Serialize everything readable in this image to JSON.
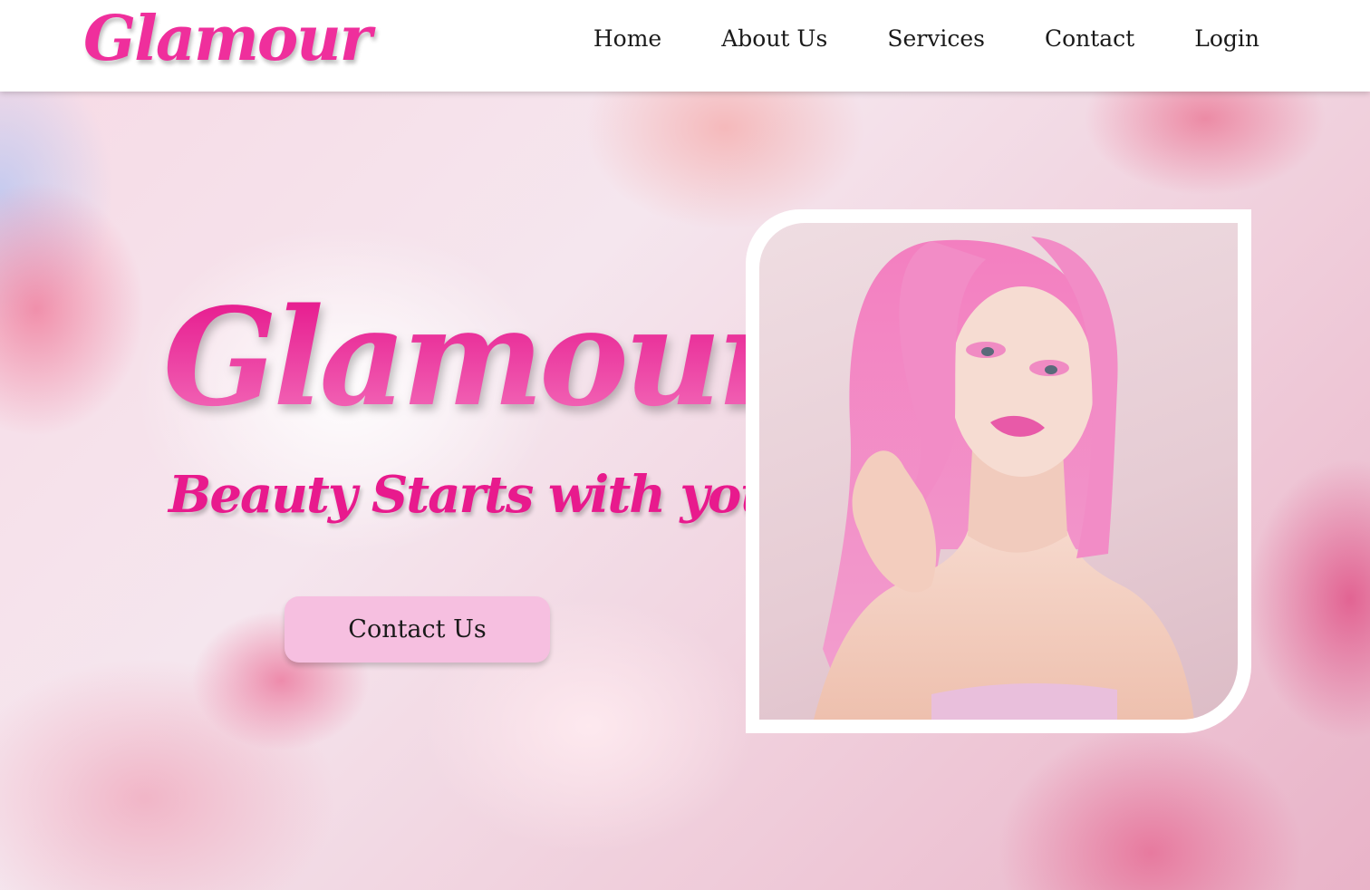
{
  "header": {
    "logo": "Glamour",
    "nav": [
      {
        "label": "Home"
      },
      {
        "label": "About Us"
      },
      {
        "label": "Services"
      },
      {
        "label": "Contact"
      },
      {
        "label": "Login"
      }
    ]
  },
  "hero": {
    "title": "Glamour",
    "tagline": "Beauty Starts with you",
    "cta_label": "Contact Us",
    "portrait_alt": "Model with pink hair"
  },
  "colors": {
    "brand_pink": "#ef2f9c",
    "button_pink": "#f6bfe0",
    "header_bg": "#ffffff",
    "text_dark": "#1a1a1a"
  }
}
